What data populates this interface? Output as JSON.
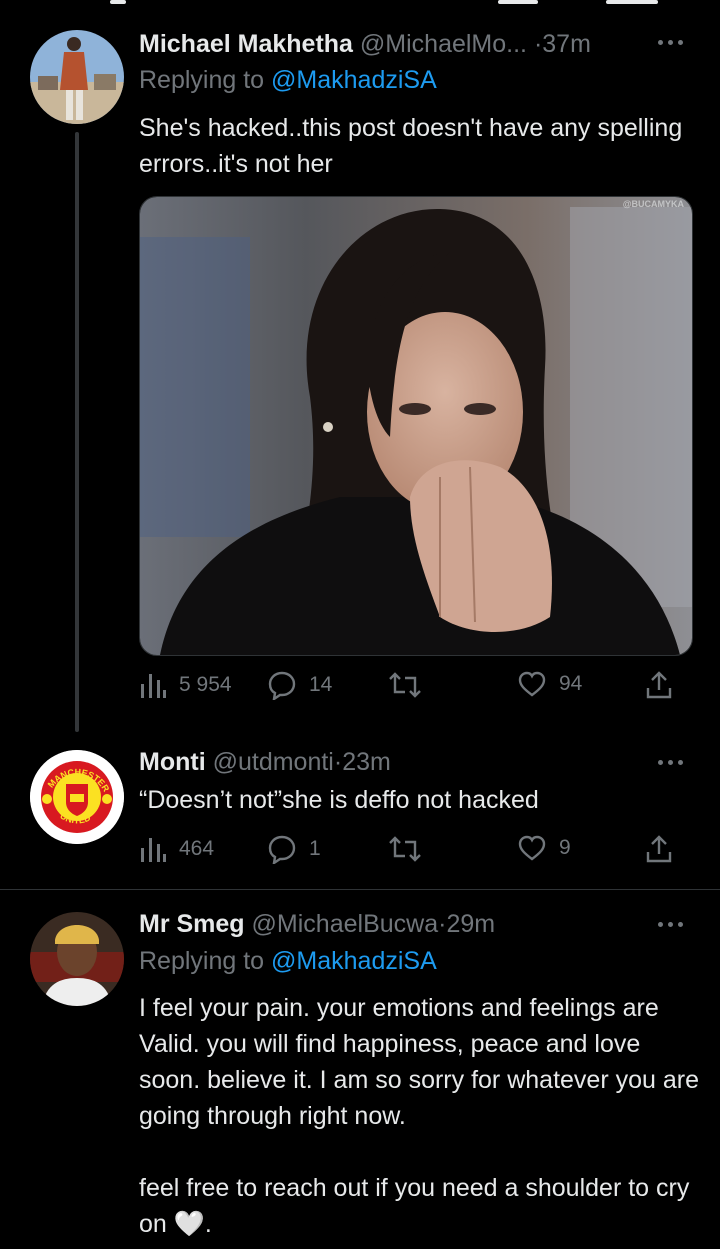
{
  "tweets": [
    {
      "name": "Michael Makhetha",
      "handle": "@MichaelMo...",
      "dot": "·",
      "time": "37m",
      "replying_label": "Replying to",
      "replying_handle": "@MakhadziSA",
      "text": "She's hacked..this post doesn't have any spelling errors..it's not her",
      "watermark": "@BUCAMYKA",
      "views": "5 954",
      "replies": "14",
      "retweets": "",
      "likes": "94"
    },
    {
      "name": "Monti",
      "handle": "@utdmonti",
      "dot": "·",
      "time": "23m",
      "text": "“Doesn’t not”she is deffo not hacked",
      "badge_top": "MANCHESTER",
      "badge_bottom": "UNITED",
      "views": "464",
      "replies": "1",
      "retweets": "",
      "likes": "9"
    },
    {
      "name": "Mr Smeg",
      "handle": "@MichaelBucwa",
      "dot": "·",
      "time": "29m",
      "replying_label": "Replying to",
      "replying_handle": "@MakhadziSA",
      "text": "I feel your pain. your emotions and feelings are Valid. you will find happiness, peace and love soon. believe it. I am so sorry for whatever you are going through right now.\n\nfeel free to reach out if you need a shoulder to cry on 🤍."
    }
  ],
  "colors": {
    "background": "#000000",
    "text": "#e7e9ea",
    "muted": "#71767b",
    "link": "#1d9bf0",
    "divider": "#2f3336"
  }
}
